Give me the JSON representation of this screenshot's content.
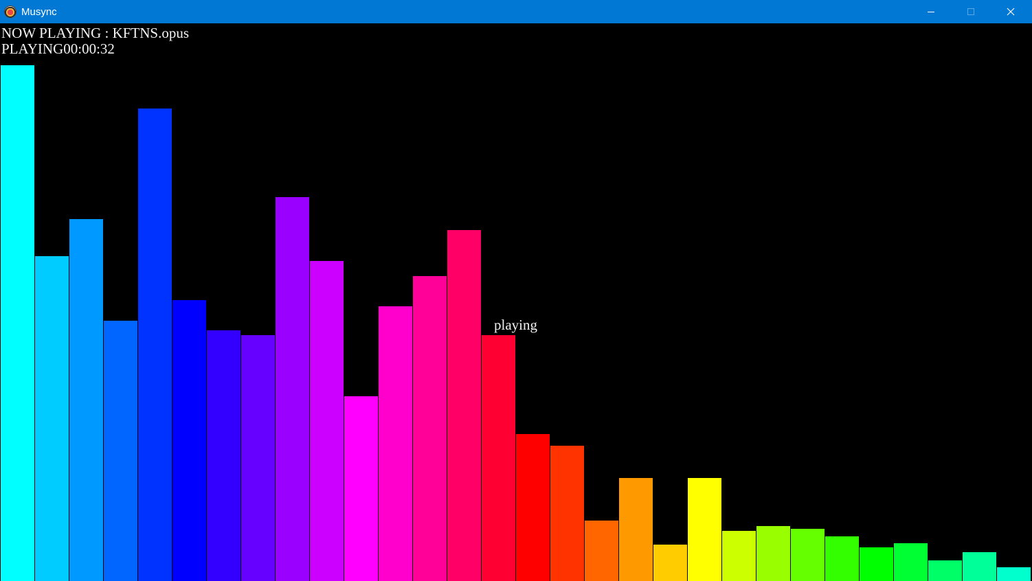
{
  "window": {
    "title": "Musync",
    "app_icon": "musync-app-icon",
    "controls": {
      "minimize_icon": "minimize-icon",
      "maximize_icon": "maximize-icon",
      "close_icon": "close-icon"
    },
    "titlebar_color": "#0078d4"
  },
  "player": {
    "now_playing_label": "NOW PLAYING : KFTNS.opus",
    "playback_line": "PLAYING00:00:32",
    "status_label": "playing"
  },
  "chart_data": {
    "type": "bar",
    "background": "#000000",
    "ylim": [
      0,
      1
    ],
    "values": [
      0.925,
      0.582,
      0.649,
      0.467,
      0.847,
      0.504,
      0.449,
      0.441,
      0.689,
      0.574,
      0.331,
      0.492,
      0.547,
      0.629,
      0.441,
      0.263,
      0.243,
      0.108,
      0.185,
      0.065,
      0.185,
      0.09,
      0.098,
      0.094,
      0.08,
      0.06,
      0.068,
      0.037,
      0.052,
      0.025
    ],
    "colors": [
      "#00ffff",
      "#00ccff",
      "#0099ff",
      "#0066ff",
      "#0033ff",
      "#0000ff",
      "#3300ff",
      "#6600ff",
      "#9900ff",
      "#cc00ff",
      "#ff00ff",
      "#ff00cc",
      "#ff0099",
      "#ff0066",
      "#ff0033",
      "#ff0000",
      "#ff3300",
      "#ff6600",
      "#ff9900",
      "#ffcc00",
      "#ffff00",
      "#ccff00",
      "#99ff00",
      "#66ff00",
      "#33ff00",
      "#00ff00",
      "#00ff33",
      "#00ff66",
      "#00ff99",
      "#00ffcc"
    ]
  }
}
